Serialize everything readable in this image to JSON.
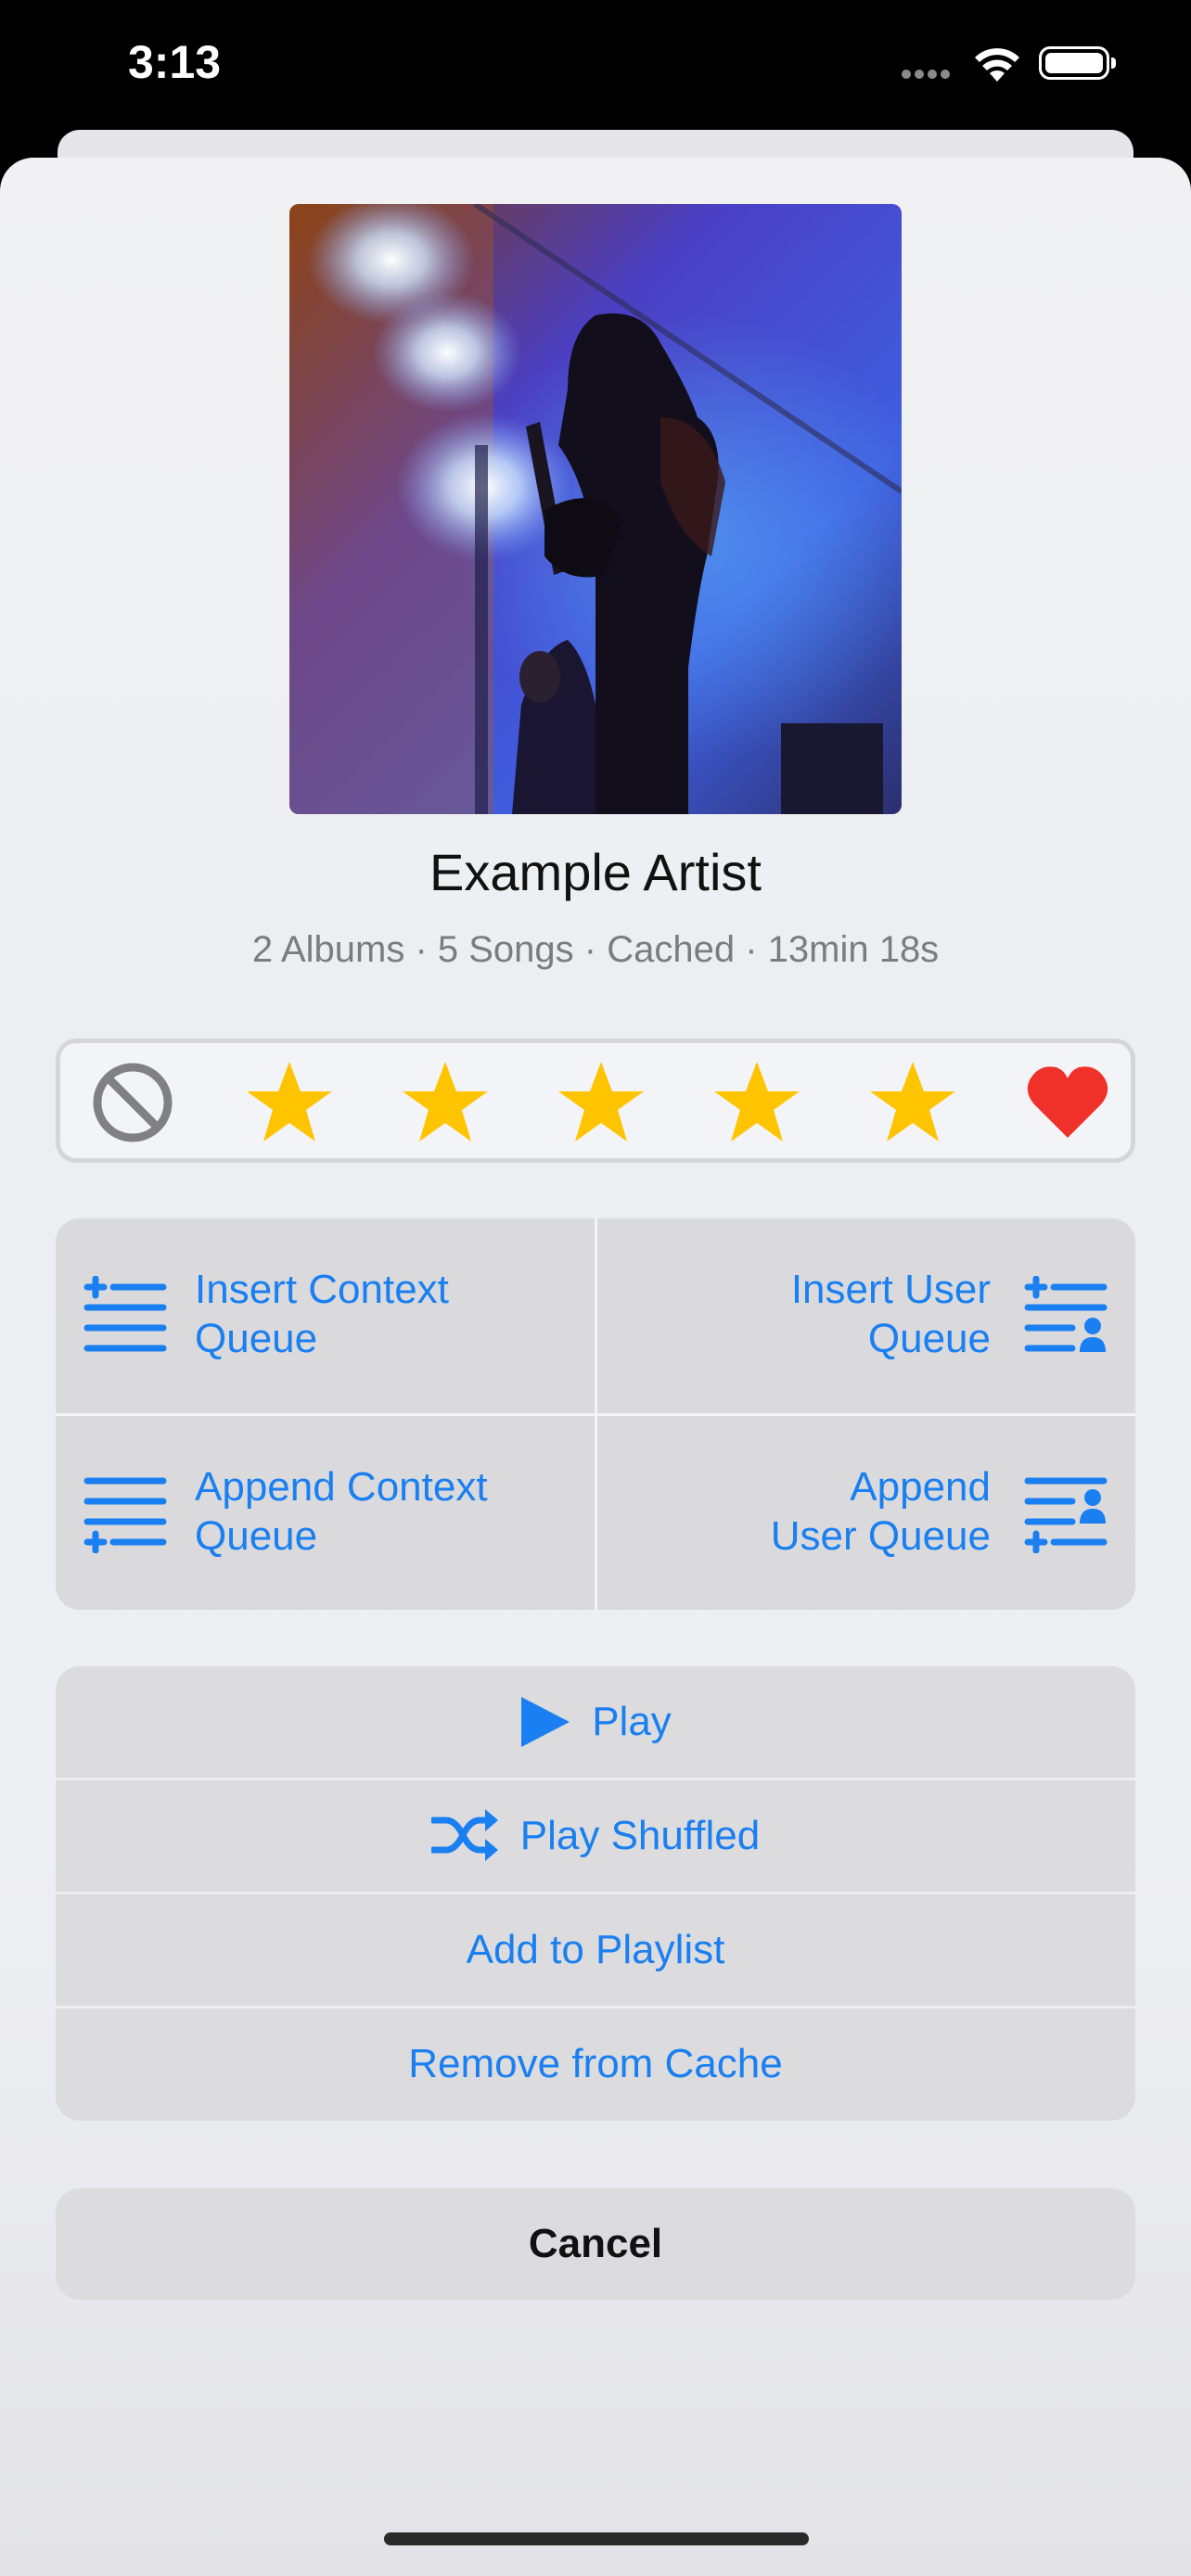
{
  "status_bar": {
    "time": "3:13"
  },
  "artist": {
    "name": "Example Artist",
    "info": "2 Albums · 5 Songs · Cached · 13min 18s"
  },
  "rating": {
    "stars": 5,
    "max_stars": 5,
    "favorite": true,
    "star_color": "#ffc400",
    "heart_color": "#f0312a"
  },
  "queue_actions": {
    "insert_context": "Insert Context\nQueue",
    "insert_user": "Insert User\nQueue",
    "append_context": "Append Context\nQueue",
    "append_user": "Append\nUser Queue"
  },
  "actions": {
    "play": "Play",
    "play_shuffled": "Play Shuffled",
    "add_to_playlist": "Add to Playlist",
    "remove_from_cache": "Remove from Cache"
  },
  "cancel": "Cancel",
  "colors": {
    "accent": "#1a7ff0"
  }
}
